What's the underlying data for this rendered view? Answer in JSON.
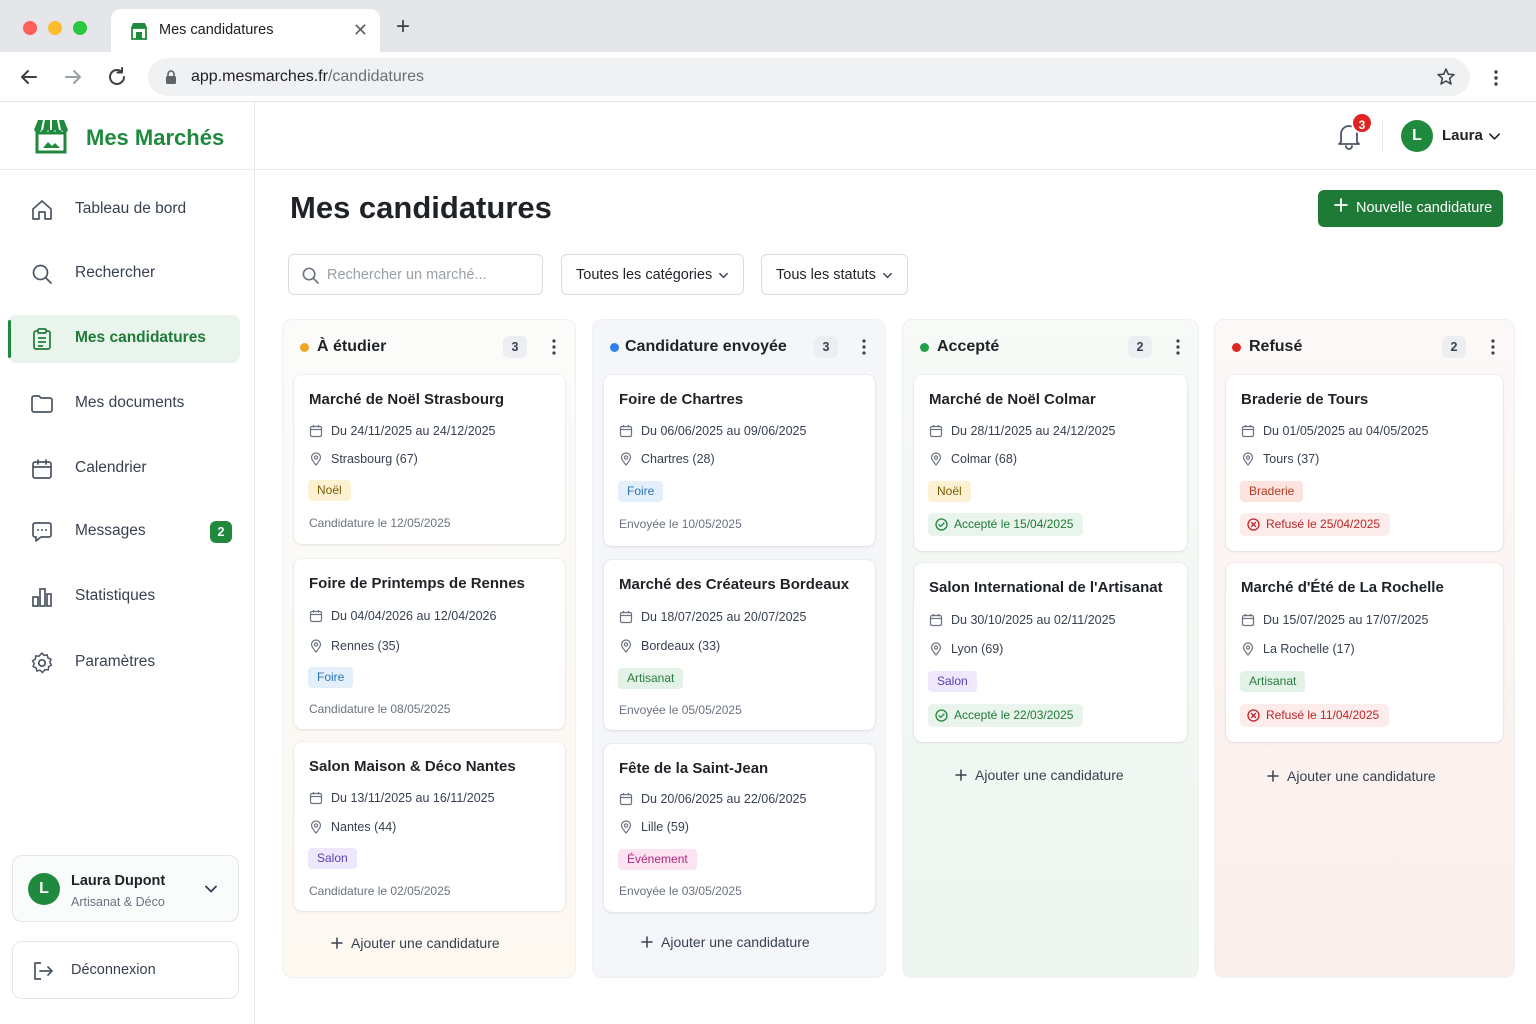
{
  "browser": {
    "tab_title": "Mes candidatures",
    "url_host": "app.mesmarches.fr",
    "url_path": "/candidatures"
  },
  "brand": {
    "name": "Mes Marchés",
    "color": "#1f8a3d"
  },
  "sidebar": {
    "items": [
      {
        "label": "Tableau de bord",
        "icon": "home-icon"
      },
      {
        "label": "Rechercher",
        "icon": "search-icon"
      },
      {
        "label": "Mes candidatures",
        "icon": "clipboard-icon",
        "active": true
      },
      {
        "label": "Mes documents",
        "icon": "folder-icon"
      },
      {
        "label": "Calendrier",
        "icon": "calendar-icon"
      },
      {
        "label": "Messages",
        "icon": "chat-icon",
        "badge": "2"
      },
      {
        "label": "Statistiques",
        "icon": "bar-chart-icon"
      },
      {
        "label": "Paramètres",
        "icon": "gear-icon"
      }
    ],
    "user": {
      "initial": "L",
      "name": "Laura Dupont",
      "role": "Artisanat & Déco"
    },
    "logout_label": "Déconnexion"
  },
  "header": {
    "notifications_count": "3",
    "user_initial": "L",
    "user_name": "Laura"
  },
  "page": {
    "title": "Mes candidatures",
    "new_button": "Nouvelle candidature",
    "search_placeholder": "Rechercher un marché...",
    "filter_category": "Toutes les catégories",
    "filter_status": "Tous les statuts"
  },
  "board": {
    "add_label": "Ajouter une candidature",
    "columns": [
      {
        "title": "À étudier",
        "count": "3",
        "dot_color": "#f5a524",
        "cards": [
          {
            "title": "Marché de Noël Strasbourg",
            "dates": "Du 24/11/2025 au 24/12/2025",
            "location": "Strasbourg (67)",
            "tag": "Noël",
            "footer": "Candidature le 12/05/2025"
          },
          {
            "title": "Foire de Printemps de Rennes",
            "dates": "Du 04/04/2026 au 12/04/2026",
            "location": "Rennes (35)",
            "tag": "Foire",
            "footer": "Candidature le 08/05/2025"
          },
          {
            "title": "Salon Maison & Déco Nantes",
            "dates": "Du 13/11/2025 au 16/11/2025",
            "location": "Nantes (44)",
            "tag": "Salon",
            "footer": "Candidature le 02/05/2025"
          }
        ]
      },
      {
        "title": "Candidature envoyée",
        "count": "3",
        "dot_color": "#2f80ed",
        "cards": [
          {
            "title": "Foire de Chartres",
            "dates": "Du 06/06/2025 au 09/06/2025",
            "location": "Chartres (28)",
            "tag": "Foire",
            "footer": "Envoyée le 10/05/2025"
          },
          {
            "title": "Marché des Créateurs Bordeaux",
            "dates": "Du 18/07/2025 au 20/07/2025",
            "location": "Bordeaux (33)",
            "tag": "Artisanat",
            "footer": "Envoyée le 05/05/2025"
          },
          {
            "title": "Fête de la Saint-Jean",
            "dates": "Du 20/06/2025 au 22/06/2025",
            "location": "Lille (59)",
            "tag": "Événement",
            "footer": "Envoyée le 03/05/2025"
          }
        ]
      },
      {
        "title": "Accepté",
        "count": "2",
        "dot_color": "#22a045",
        "cards": [
          {
            "title": "Marché de Noël Colmar",
            "dates": "Du 28/11/2025 au 24/12/2025",
            "location": "Colmar (68)",
            "tag": "Noël",
            "status": "Accepté le 15/04/2025"
          },
          {
            "title": "Salon International de l'Artisanat",
            "dates": "Du 30/10/2025 au 02/11/2025",
            "location": "Lyon (69)",
            "tag": "Salon",
            "status": "Accepté le 22/03/2025"
          }
        ]
      },
      {
        "title": "Refusé",
        "count": "2",
        "dot_color": "#e02424",
        "cards": [
          {
            "title": "Braderie de Tours",
            "dates": "Du 01/05/2025 au 04/05/2025",
            "location": "Tours (37)",
            "tag": "Braderie",
            "status": "Refusé le 25/04/2025"
          },
          {
            "title": "Marché d'Été de La Rochelle",
            "dates": "Du 15/07/2025 au 17/07/2025",
            "location": "La Rochelle (17)",
            "tag": "Artisanat",
            "status": "Refusé le 11/04/2025"
          }
        ]
      }
    ]
  }
}
